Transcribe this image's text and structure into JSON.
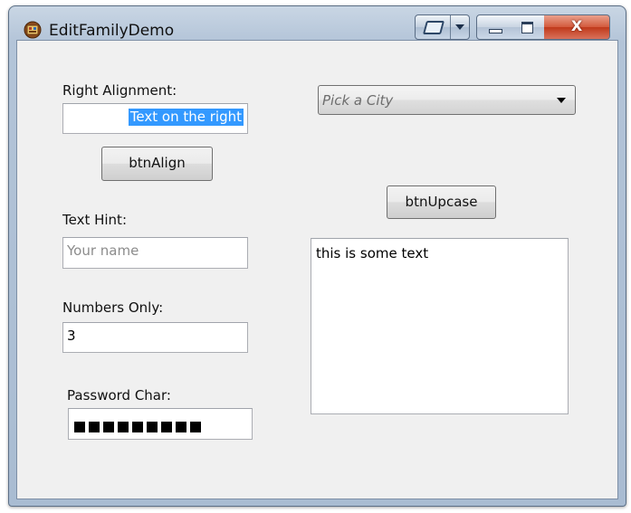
{
  "window": {
    "title": "EditFamilyDemo",
    "close_glyph": "X"
  },
  "form": {
    "right_alignment_label": "Right Alignment:",
    "right_alignment_value": "Text on the right",
    "btn_align_label": "btnAlign",
    "text_hint_label": "Text Hint:",
    "text_hint_placeholder": "Your name",
    "numbers_only_label": "Numbers Only:",
    "numbers_only_value": "3",
    "password_label": "Password Char:",
    "password_mask_count": 9,
    "city_combo_placeholder": "Pick a City",
    "btn_upcase_label": "btnUpcase",
    "memo_text": "this is some text"
  },
  "colors": {
    "selection": "#3399ff",
    "close_button": "#c0391b"
  },
  "icons": [
    "app-icon",
    "task-switch-icon",
    "dropdown-arrow-icon",
    "minimize-icon",
    "maximize-icon",
    "close-icon"
  ]
}
